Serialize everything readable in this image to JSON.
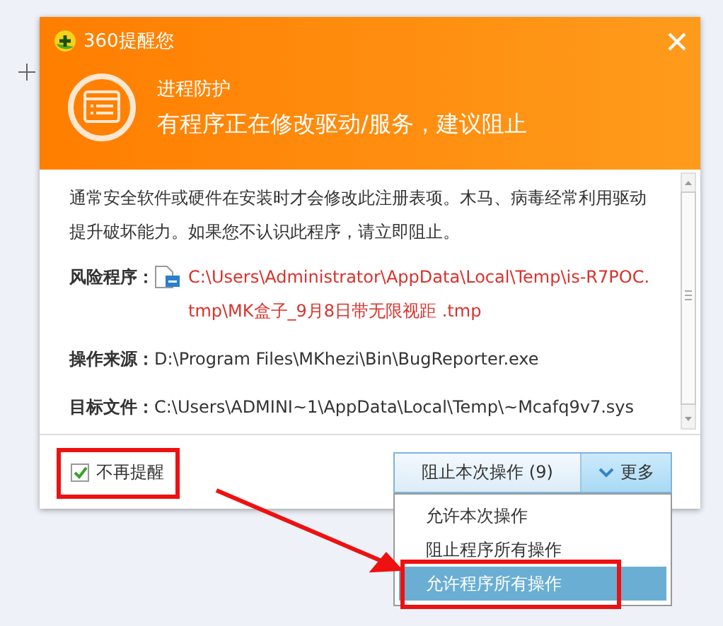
{
  "window": {
    "title": "360提醒您"
  },
  "header": {
    "category": "进程防护",
    "headline": "有程序正在修改驱动/服务，建议阻止"
  },
  "description": "通常安全软件或硬件在安装时才会修改此注册表项。木马、病毒经常利用驱动提升破坏能力。如果您不认识此程序，请立即阻止。",
  "fields": [
    {
      "kind": "risk",
      "label": "风险程序：",
      "value": "C:\\Users\\Administrator\\AppData\\Local\\Temp\\is-R7POC.tmp\\MK盒子_9月8日带无限视距 .tmp"
    },
    {
      "kind": "plain",
      "label": "操作来源：",
      "value": "D:\\Program Files\\MKhezi\\Bin\\BugReporter.exe"
    },
    {
      "kind": "plain",
      "label": "目标文件：",
      "value": "C:\\Users\\ADMINI~1\\AppData\\Local\\Temp\\~Mcafq9v7.sys"
    }
  ],
  "footer": {
    "dont_remind": {
      "label": "不再提醒",
      "checked": true
    },
    "primary_button": "阻止本次操作 (9)",
    "more_button": {
      "label": "更多",
      "expanded": true
    }
  },
  "menu": {
    "items": [
      {
        "label": "允许本次操作",
        "selected": false
      },
      {
        "label": "阻止程序所有操作",
        "selected": false
      },
      {
        "label": "允许程序所有操作",
        "selected": true
      }
    ]
  }
}
